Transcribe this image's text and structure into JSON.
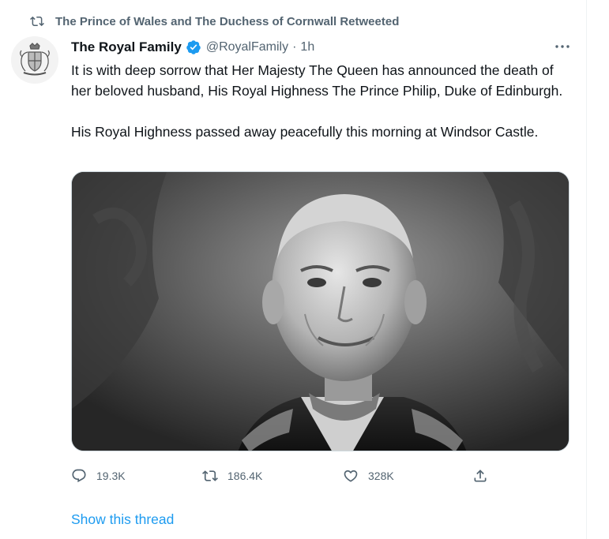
{
  "social_context": {
    "text": "The Prince of Wales and The Duchess of Cornwall Retweeted",
    "icon": "retweet-icon"
  },
  "tweet": {
    "author_name": "The Royal Family",
    "verified": true,
    "handle": "@RoyalFamily",
    "separator": "·",
    "time": "1h",
    "paragraphs": [
      "It is with deep sorrow that Her Majesty The Queen has announced the death of her beloved husband, His Royal Highness The Prince Philip, Duke of Edinburgh.",
      "His Royal Highness passed away peacefully this morning at Windsor Castle."
    ],
    "media_description": "black-and-white portrait photograph",
    "actions": {
      "replies": "19.3K",
      "retweets": "186.4K",
      "likes": "328K"
    },
    "show_thread": "Show this thread"
  },
  "colors": {
    "accent": "#1d9bf0",
    "secondary_text": "#536471",
    "primary_text": "#0f1419"
  }
}
